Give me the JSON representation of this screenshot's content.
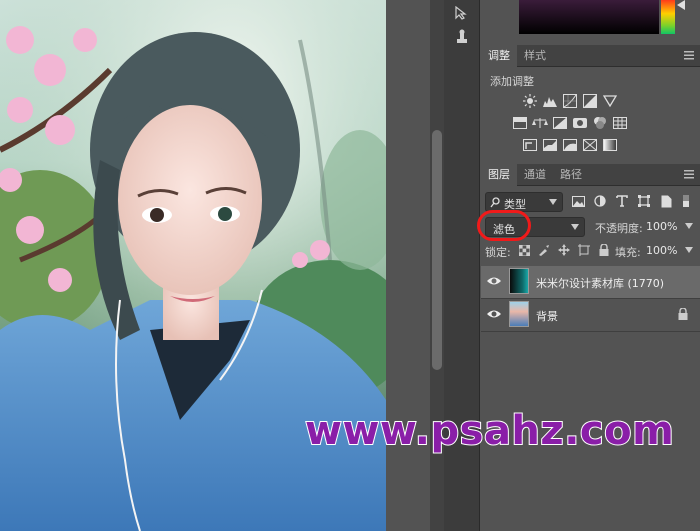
{
  "panels": {
    "adjustments": {
      "tabs": [
        "调整",
        "样式"
      ],
      "title": "添加调整"
    },
    "layers": {
      "tabs": [
        "图层",
        "通道",
        "路径"
      ],
      "filter_kind": "类型",
      "blend_mode": "滤色",
      "opacity_label": "不透明度:",
      "opacity_value": "100%",
      "lock_label": "锁定:",
      "fill_label": "填充:",
      "fill_value": "100%",
      "items": [
        {
          "name": "米米尔设计素材库 (1770)",
          "visible": true,
          "selected": true
        },
        {
          "name": "背景",
          "visible": true,
          "locked": true
        }
      ]
    }
  },
  "annotation": {
    "highlight_color": "#f01a1a"
  },
  "watermark": {
    "text": "www.psahz.com",
    "color": "#8a1ea8"
  },
  "icons": [
    "path-select-icon",
    "stamp-icon",
    "brightness-icon",
    "levels-icon",
    "curves-icon",
    "exposure-icon",
    "vibrance-icon",
    "hue-sat-icon",
    "color-balance-icon",
    "black-white-icon",
    "photo-filter-icon",
    "channel-mixer-icon",
    "color-lookup-icon",
    "invert-icon",
    "posterize-icon",
    "threshold-icon",
    "selective-color-icon",
    "gradient-map-icon",
    "search-icon",
    "pixel-filter-icon",
    "adjust-filter-icon",
    "type-filter-icon",
    "shape-filter-icon",
    "smart-filter-icon",
    "eye-icon",
    "lock-icon",
    "panel-menu-icon"
  ]
}
